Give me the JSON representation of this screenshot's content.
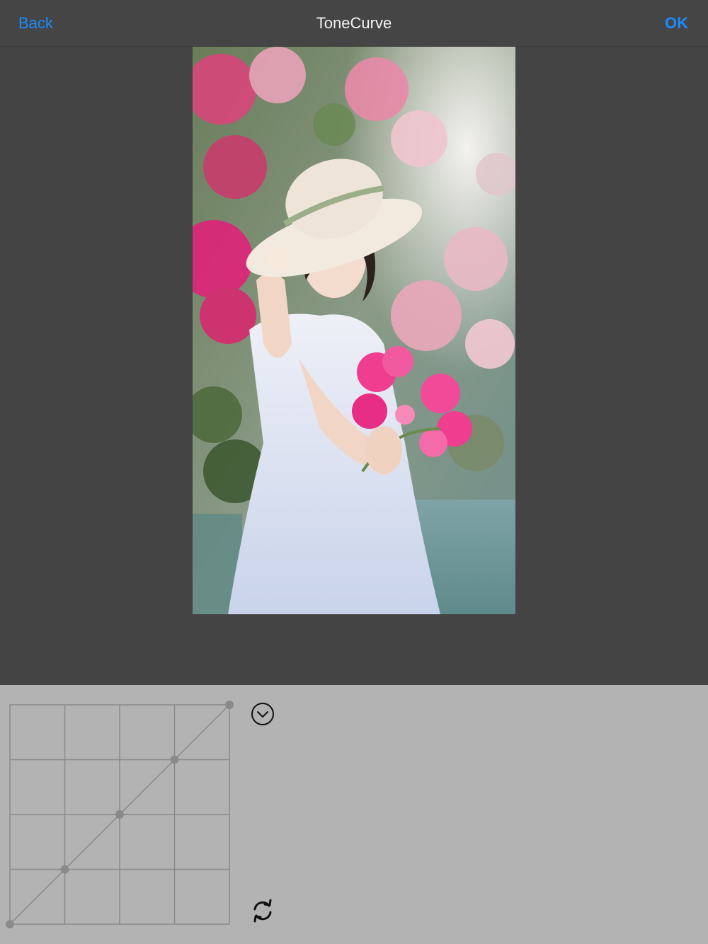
{
  "navbar": {
    "back_label": "Back",
    "title": "ToneCurve",
    "ok_label": "OK"
  },
  "colors": {
    "accent": "#1a8cff",
    "navbar_bg": "#454545",
    "viewer_bg": "#444444",
    "panel_bg": "#b3b3b3",
    "curve": "#8a8a8a"
  },
  "photo": {
    "description_icon": "photo-preview"
  },
  "tone_curve": {
    "grid_divisions": 4,
    "points": [
      {
        "input": 0.0,
        "output": 0.0
      },
      {
        "input": 0.25,
        "output": 0.25
      },
      {
        "input": 0.5,
        "output": 0.5
      },
      {
        "input": 0.75,
        "output": 0.75
      },
      {
        "input": 1.0,
        "output": 1.0
      }
    ]
  },
  "controls": {
    "channel_dropdown_icon": "chevron-down-circle-icon",
    "reset_icon": "refresh-icon"
  }
}
